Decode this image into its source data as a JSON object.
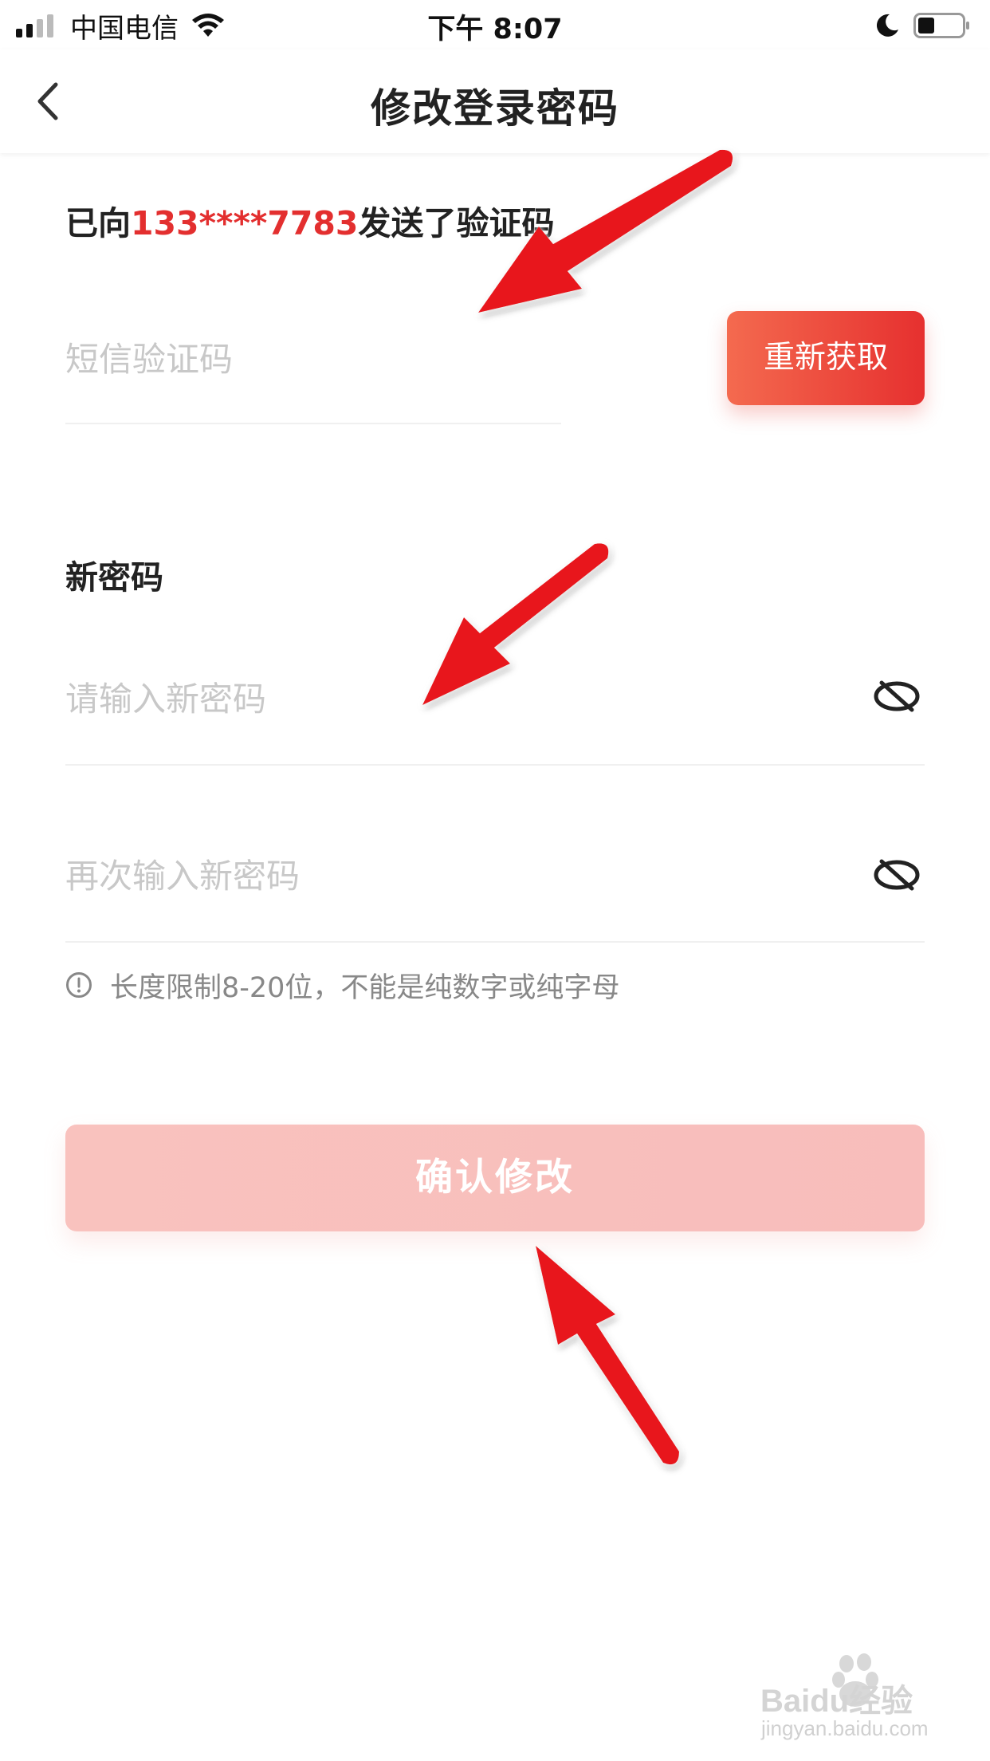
{
  "status_bar": {
    "carrier": "中国电信",
    "time": "下午 8:07"
  },
  "nav": {
    "title": "修改登录密码"
  },
  "verification": {
    "sent_prefix": "已向",
    "phone": "133****7783",
    "sent_suffix": "发送了验证码",
    "sms_placeholder": "短信验证码",
    "resend_label": "重新获取"
  },
  "new_password": {
    "label": "新密码",
    "placeholder": "请输入新密码",
    "confirm_placeholder": "再次输入新密码",
    "hint": "长度限制8-20位，不能是纯数字或纯字母"
  },
  "actions": {
    "confirm_label": "确认修改"
  },
  "watermark": {
    "brand": "Baidu经验",
    "url": "jingyan.baidu.com"
  },
  "colors": {
    "accent": "#e32f2f",
    "resend_gradient_start": "#f46a4f",
    "resend_gradient_end": "#e6302f",
    "confirm_disabled": "#f9c2be",
    "annotation_arrow": "#e8121b"
  }
}
